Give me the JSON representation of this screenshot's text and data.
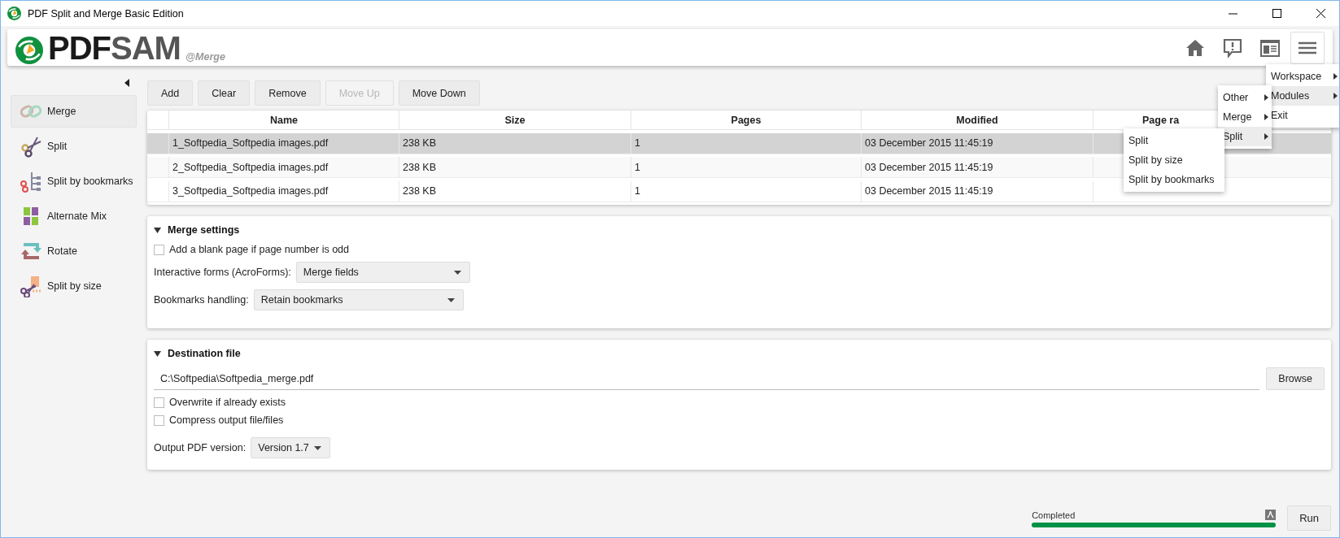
{
  "window": {
    "title": "PDF Split and Merge Basic Edition"
  },
  "header": {
    "logo_dark": "PDF",
    "logo_light": "SAM",
    "module": "@Merge"
  },
  "sidebar": {
    "items": [
      {
        "label": "Merge",
        "kind": "merge",
        "selected": true
      },
      {
        "label": "Split",
        "kind": "split",
        "selected": false
      },
      {
        "label": "Split by bookmarks",
        "kind": "bookmarks",
        "selected": false
      },
      {
        "label": "Alternate Mix",
        "kind": "mix",
        "selected": false
      },
      {
        "label": "Rotate",
        "kind": "rotate",
        "selected": false
      },
      {
        "label": "Split by size",
        "kind": "size",
        "selected": false
      }
    ]
  },
  "toolbar": [
    {
      "label": "Add",
      "disabled": false
    },
    {
      "label": "Clear",
      "disabled": false
    },
    {
      "label": "Remove",
      "disabled": false
    },
    {
      "label": "Move Up",
      "disabled": true
    },
    {
      "label": "Move Down",
      "disabled": false
    }
  ],
  "table": {
    "columns": [
      "Name",
      "Size",
      "Pages",
      "Modified",
      "Page ra"
    ],
    "rows": [
      {
        "selected": true,
        "cells": [
          "1_Softpedia_Softpedia images.pdf",
          "238 KB",
          "1",
          "03 December 2015 11:45:19"
        ]
      },
      {
        "selected": false,
        "cells": [
          "2_Softpedia_Softpedia images.pdf",
          "238 KB",
          "1",
          "03 December 2015 11:45:19"
        ]
      },
      {
        "selected": false,
        "cells": [
          "3_Softpedia_Softpedia images.pdf",
          "238 KB",
          "1",
          "03 December 2015 11:45:19"
        ]
      }
    ]
  },
  "merge_settings": {
    "title": "Merge settings",
    "expanded": true,
    "checkbox": {
      "label": "Add a blank page if page number is odd",
      "checked": false
    },
    "fields": [
      {
        "label": "Interactive forms (AcroForms):",
        "value": "Merge fields"
      },
      {
        "label": "Bookmarks handling:",
        "value": "Retain bookmarks"
      }
    ]
  },
  "destination": {
    "title": "Destination file",
    "expanded": true,
    "path": "C:\\Softpedia\\Softpedia_merge.pdf",
    "browse": "Browse",
    "options": [
      {
        "label": "Overwrite if already exists",
        "checked": false
      },
      {
        "label": "Compress output file/files",
        "checked": false
      }
    ],
    "version": {
      "label": "Output PDF version:",
      "value": "Version 1.7"
    }
  },
  "footer": {
    "status": "Completed",
    "level": 1,
    "run": "Run"
  },
  "menus": {
    "main": [
      {
        "label": "Workspace",
        "submenu": true,
        "selected": false
      },
      {
        "label": "Modules",
        "submenu": true,
        "selected": true
      },
      {
        "label": "Exit",
        "submenu": false,
        "selected": false
      }
    ],
    "modules": [
      {
        "label": "Other",
        "submenu": true,
        "selected": false
      },
      {
        "label": "Merge",
        "submenu": true,
        "selected": false
      },
      {
        "label": "Split",
        "submenu": true,
        "selected": true
      }
    ],
    "split": [
      {
        "label": "Split",
        "submenu": false,
        "selected": false
      },
      {
        "label": "Split by size",
        "submenu": false,
        "selected": false
      },
      {
        "label": "Split by bookmarks",
        "submenu": false,
        "selected": false
      }
    ]
  }
}
